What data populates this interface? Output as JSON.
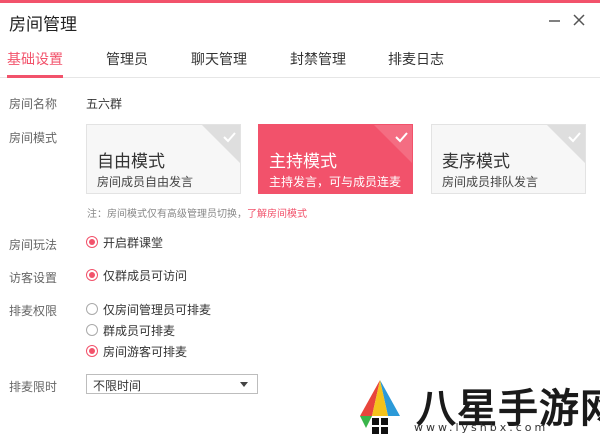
{
  "window": {
    "title": "房间管理"
  },
  "tabs": [
    {
      "label": "基础设置"
    },
    {
      "label": "管理员"
    },
    {
      "label": "聊天管理"
    },
    {
      "label": "封禁管理"
    },
    {
      "label": "排麦日志"
    }
  ],
  "room_name": {
    "label": "房间名称",
    "value": "五六群"
  },
  "room_mode": {
    "label": "房间模式",
    "cards": [
      {
        "title": "自由模式",
        "desc": "房间成员自由发言",
        "selected": false
      },
      {
        "title": "主持模式",
        "desc": "主持发言，可与成员连麦",
        "selected": true
      },
      {
        "title": "麦序模式",
        "desc": "房间成员排队发言",
        "selected": false
      }
    ],
    "note": "注：房间模式仅有高级管理员切换，",
    "note_link": "了解房间模式"
  },
  "room_play": {
    "label": "房间玩法",
    "option": "开启群课堂"
  },
  "visitor": {
    "label": "访客设置",
    "option": "仅群成员可访问"
  },
  "mic_permission": {
    "label": "排麦权限",
    "options": [
      {
        "label": "仅房间管理员可排麦",
        "checked": false
      },
      {
        "label": "群成员可排麦",
        "checked": false
      },
      {
        "label": "房间游客可排麦",
        "checked": true
      }
    ]
  },
  "mic_time": {
    "label": "排麦限时",
    "selected": "不限时间"
  },
  "watermark": {
    "text": "八星手游网",
    "sub": "www.lyshbx.com"
  },
  "colors": {
    "accent": "#f2526b"
  }
}
